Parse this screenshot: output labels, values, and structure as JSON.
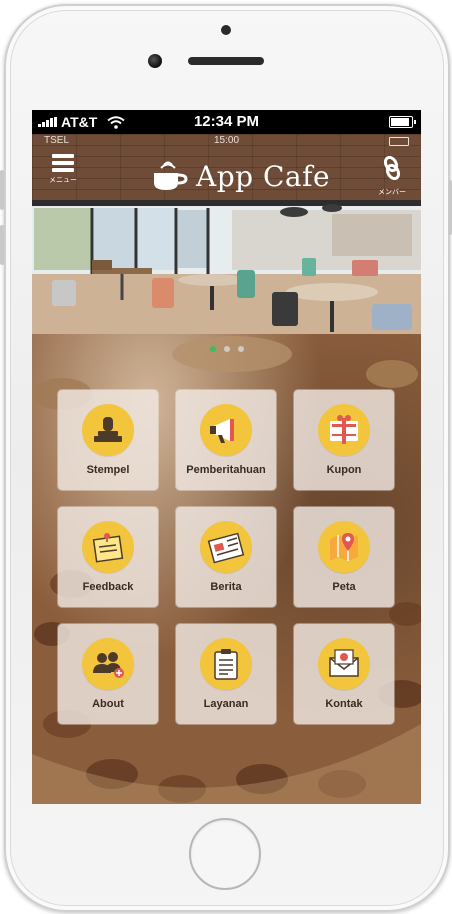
{
  "device_status": {
    "carrier": "AT&T",
    "time": "12:34 PM"
  },
  "app": {
    "inner_carrier": "TSEL",
    "inner_time": "15:00",
    "title": "App Cafe",
    "menu_label": "メニュー",
    "member_label": "メンバー"
  },
  "carousel": {
    "pages": 3,
    "active_index": 0
  },
  "tiles": [
    {
      "label": "Stempel",
      "icon": "stamp-icon"
    },
    {
      "label": "Pemberitahuan",
      "icon": "megaphone-icon"
    },
    {
      "label": "Kupon",
      "icon": "coupon-icon"
    },
    {
      "label": "Feedback",
      "icon": "note-icon"
    },
    {
      "label": "Berita",
      "icon": "newspaper-icon"
    },
    {
      "label": "Peta",
      "icon": "map-icon"
    },
    {
      "label": "About",
      "icon": "users-icon"
    },
    {
      "label": "Layanan",
      "icon": "clipboard-icon"
    },
    {
      "label": "Kontak",
      "icon": "mail-icon"
    }
  ],
  "colors": {
    "header_brick": "#6f4c37",
    "tile_bg": "#f0e8e2",
    "icon_circle": "#f2c53d",
    "active_dot": "#3bbf5a"
  }
}
